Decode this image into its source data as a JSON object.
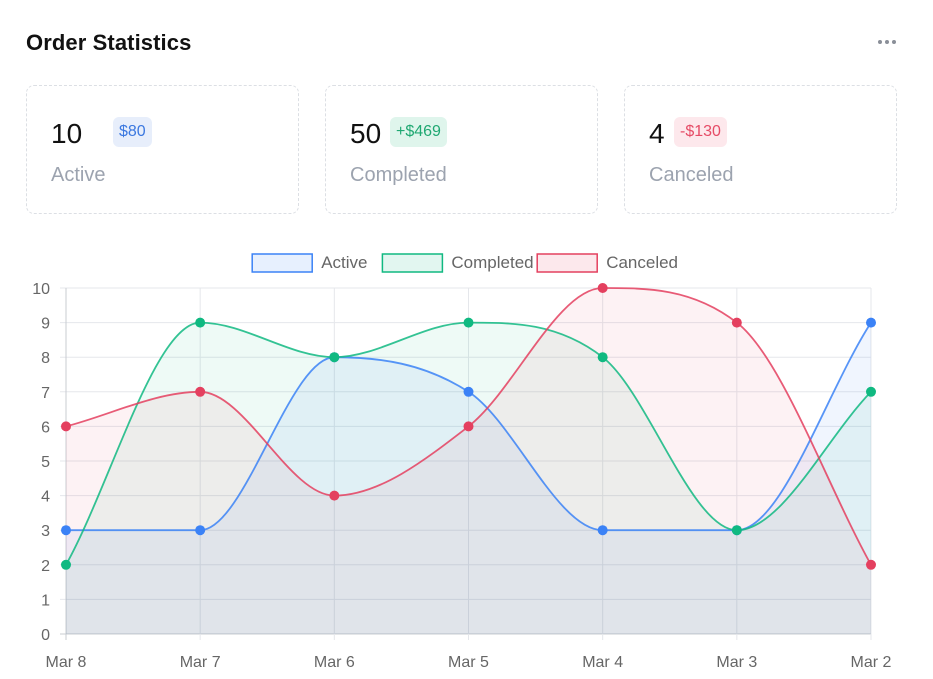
{
  "header": {
    "title": "Order Statistics",
    "menu_icon": "more-horizontal-icon"
  },
  "cards": [
    {
      "value": "10",
      "badge": "$80",
      "label": "Active",
      "accent": "#3b78e0"
    },
    {
      "value": "50",
      "badge": "+$469",
      "label": "Completed",
      "accent": "#1fa872"
    },
    {
      "value": "4",
      "badge": "-$130",
      "label": "Canceled",
      "accent": "#e64b66"
    }
  ],
  "chart_data": {
    "type": "area",
    "title": "",
    "xlabel": "",
    "ylabel": "",
    "categories": [
      "Mar 8",
      "Mar 7",
      "Mar 6",
      "Mar 5",
      "Mar 4",
      "Mar 3",
      "Mar 2"
    ],
    "ylim": [
      0,
      10
    ],
    "yticks": [
      0,
      1,
      2,
      3,
      4,
      5,
      6,
      7,
      8,
      9,
      10
    ],
    "grid": true,
    "legend_position": "top",
    "series": [
      {
        "name": "Active",
        "values": [
          3,
          3,
          8,
          7,
          3,
          3,
          9
        ],
        "color": "#3b82f6"
      },
      {
        "name": "Completed",
        "values": [
          2,
          9,
          8,
          9,
          8,
          3,
          7
        ],
        "color": "#10b981"
      },
      {
        "name": "Canceled",
        "values": [
          6,
          7,
          4,
          6,
          10,
          9,
          2
        ],
        "color": "#e4405f"
      }
    ]
  }
}
